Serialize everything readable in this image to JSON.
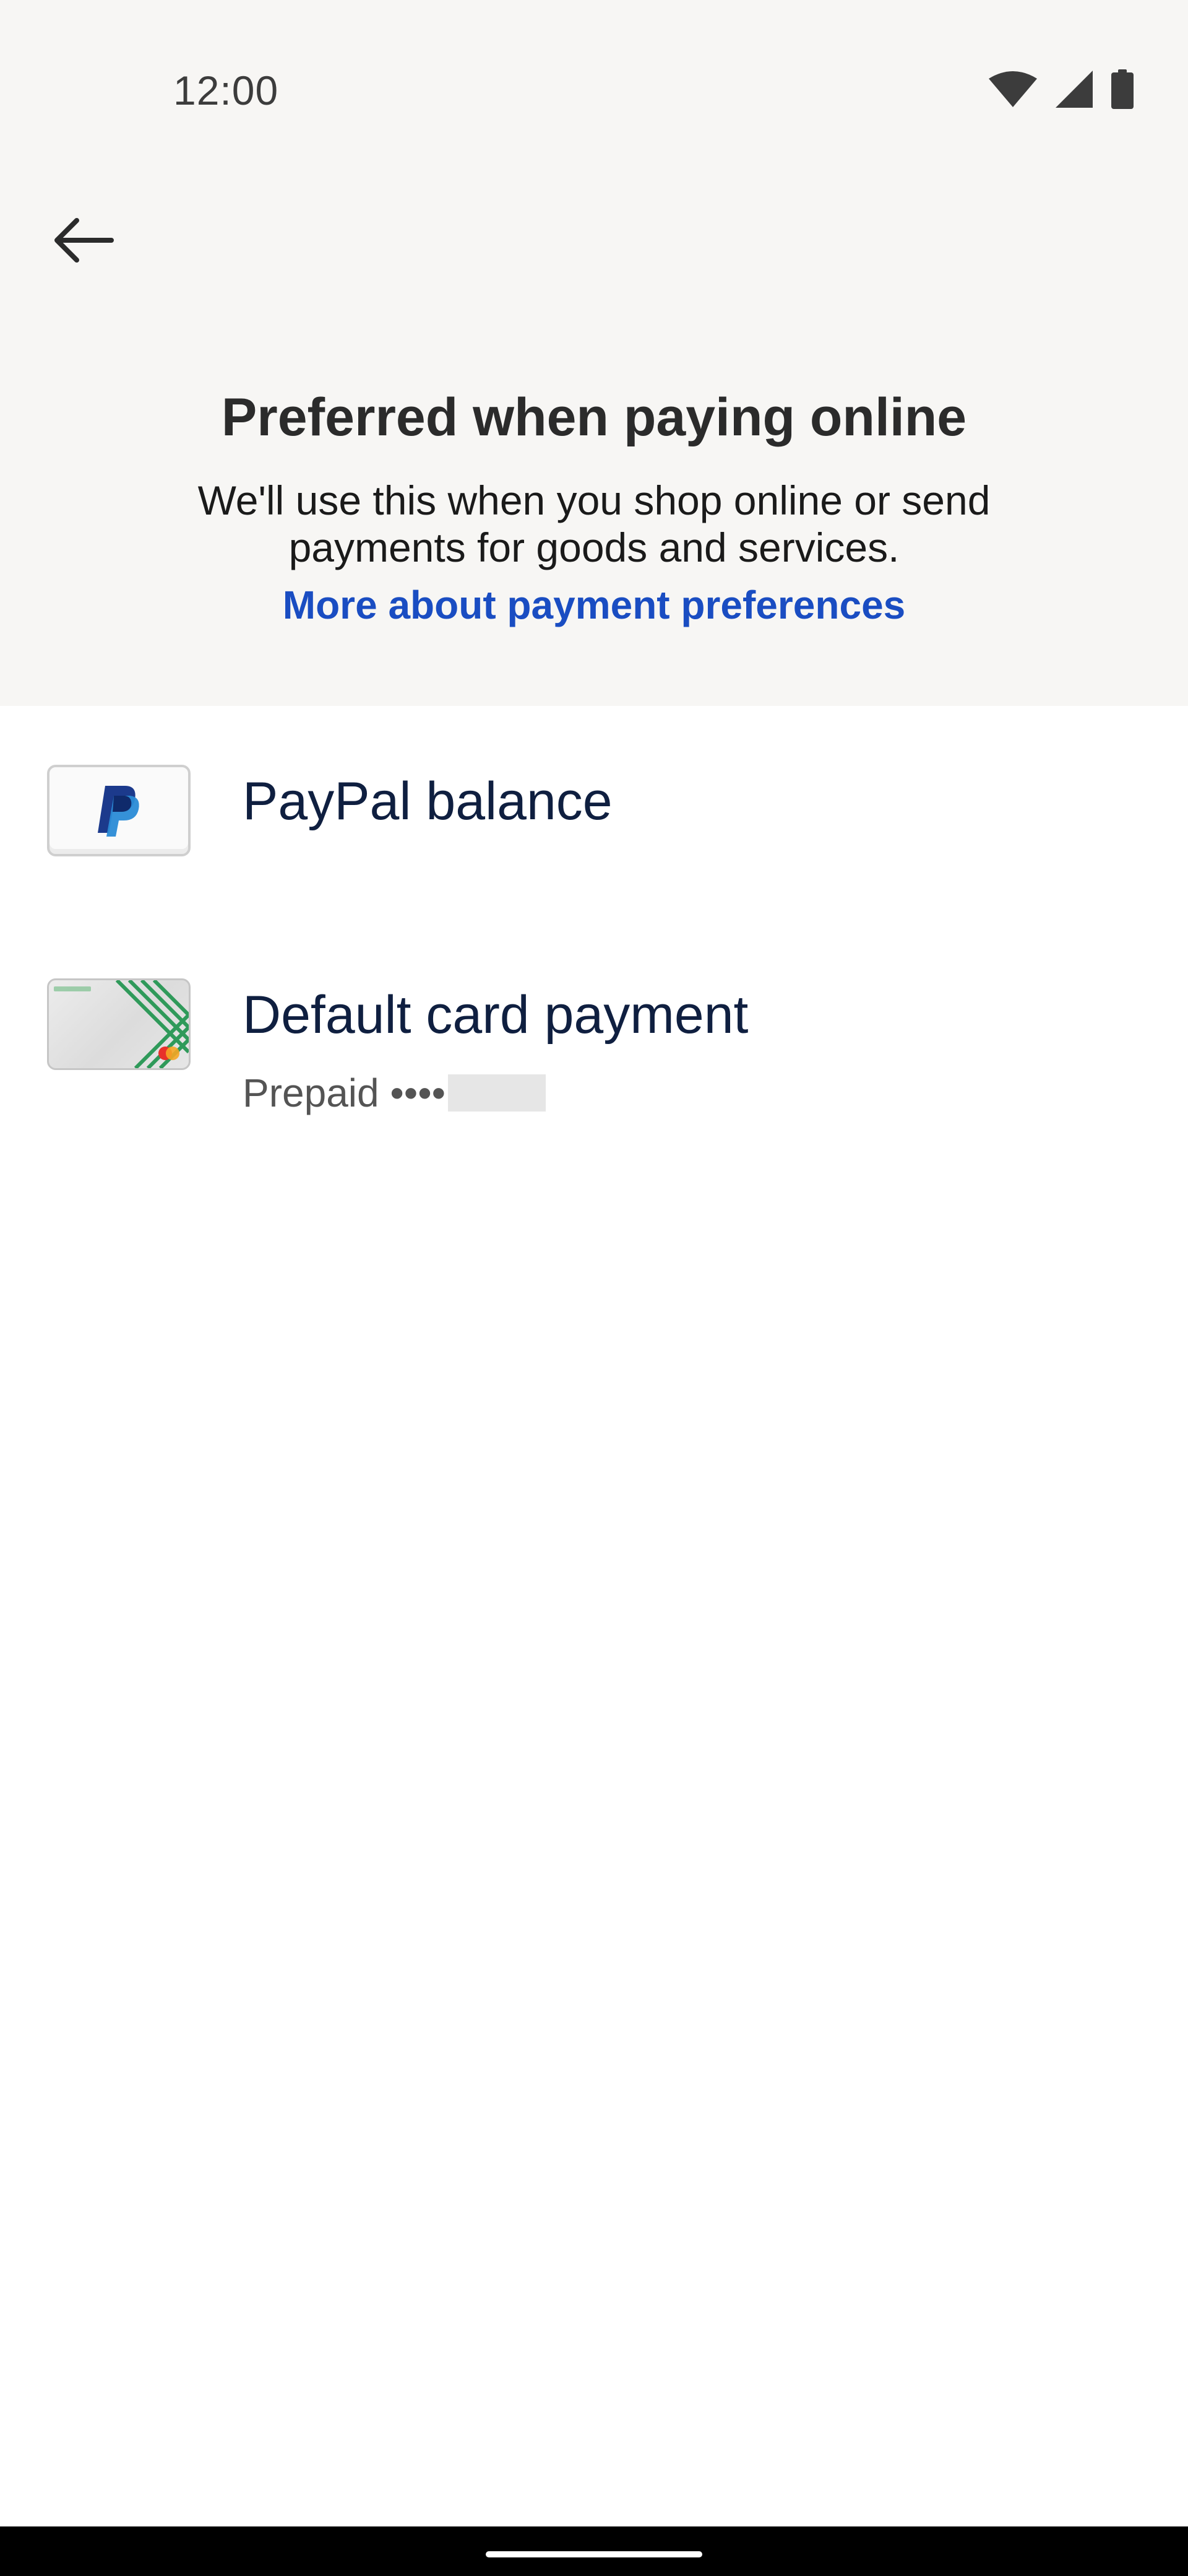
{
  "status_bar": {
    "time": "12:00",
    "icons": [
      "wifi-icon",
      "cellular-signal-icon",
      "battery-icon"
    ]
  },
  "header": {
    "back_icon": "arrow-left-icon",
    "title": "Preferred when paying online",
    "subtitle": "We'll use this when you shop online or send payments for goods and services.",
    "link": "More about payment preferences"
  },
  "payment_methods": [
    {
      "icon": "paypal-logo-icon",
      "title": "PayPal balance"
    },
    {
      "icon": "card-thumbnail-icon",
      "title": "Default card payment",
      "subtitle": "Prepaid ••••"
    }
  ],
  "colors": {
    "header_bg": "#f7f6f4",
    "link": "#1a4dc2",
    "item_title": "#0f1f40",
    "paypal_dark": "#1c3a8c",
    "paypal_light": "#2a8bd6",
    "card_stripes": "#2f9a5a"
  }
}
